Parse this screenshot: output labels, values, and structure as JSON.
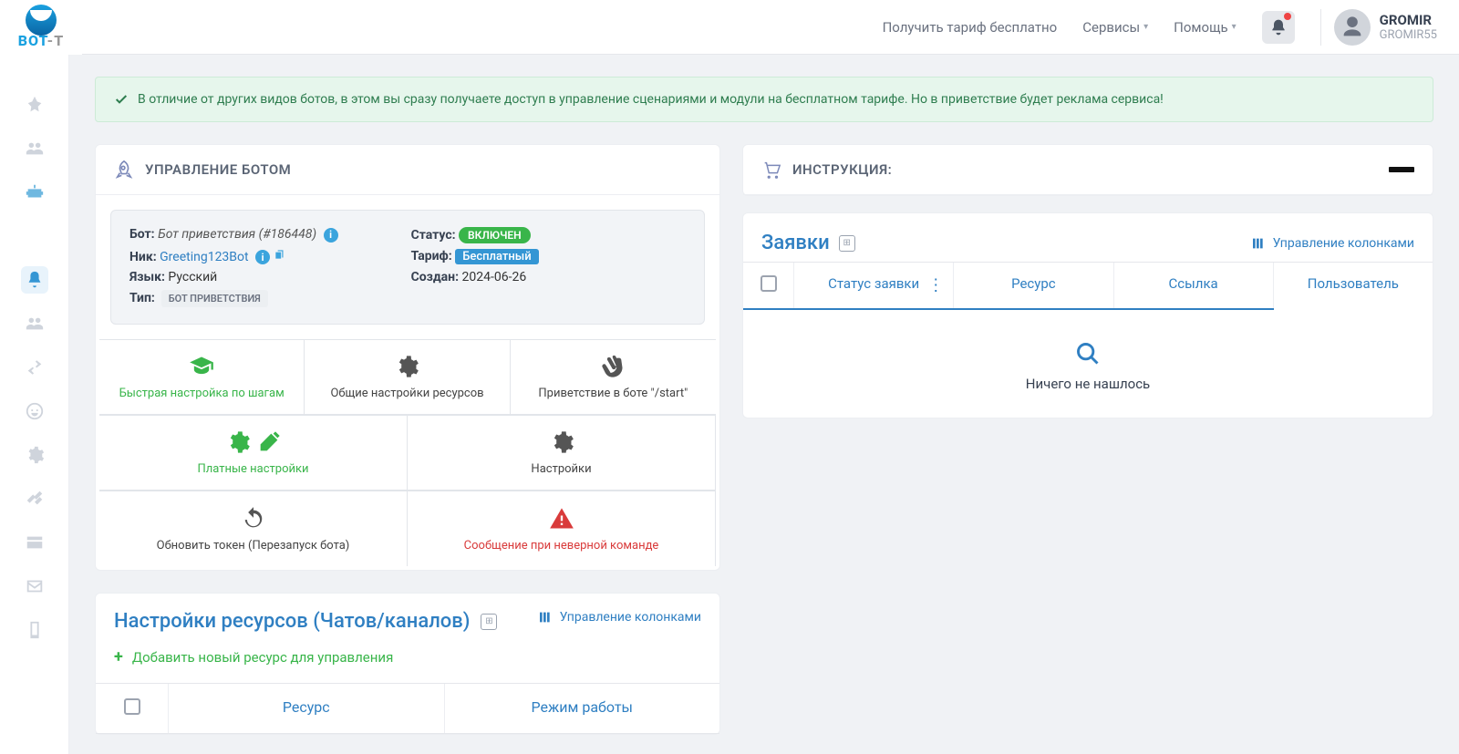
{
  "header": {
    "logo_main": "BOT",
    "logo_suffix": "-T",
    "links": {
      "free_tariff": "Получить тариф бесплатно",
      "services": "Сервисы",
      "help": "Помощь"
    },
    "user": {
      "name": "GROMIR",
      "username": "GROMIR55"
    }
  },
  "alert": "В отличие от других видов ботов, в этом вы сразу получаете доступ в управление сценариями и модули на бесплатном тарифе. Но в приветствие будет реклама сервиса!",
  "bot_panel": {
    "title": "УПРАВЛЕНИЕ БОТОМ",
    "labels": {
      "bot": "Бот:",
      "nick": "Ник:",
      "lang": "Язык:",
      "type": "Тип:",
      "status": "Статус:",
      "tariff": "Тариф:",
      "created": "Создан:"
    },
    "values": {
      "bot": "Бот приветствия (#186448)",
      "nick": "Greeting123Bot",
      "lang": "Русский",
      "type": "БОТ ПРИВЕТСТВИЯ",
      "status": "ВКЛЮЧЕН",
      "tariff": "Бесплатный",
      "created": "2024-06-26"
    },
    "tiles": {
      "quick_setup": "Быстрая настройка по шагам",
      "common_resources": "Общие настройки ресурсов",
      "greeting_bot": "Приветствие в боте \"/start\"",
      "paid_settings": "Платные настройки",
      "settings": "Настройки",
      "refresh_token": "Обновить токен (Перезапуск бота)",
      "invalid_cmd": "Сообщение при неверной команде"
    }
  },
  "instructions": {
    "title": "ИНСТРУКЦИЯ:"
  },
  "orders": {
    "title": "Заявки",
    "manage_cols": "Управление колонками",
    "columns": {
      "status": "Статус заявки",
      "resource": "Ресурс",
      "link": "Ссылка",
      "user": "Пользователь"
    },
    "empty": "Ничего не нашлось"
  },
  "resources": {
    "title": "Настройки ресурсов (Чатов/каналов)",
    "manage_cols": "Управление колонками",
    "add": "Добавить новый ресурс для управления",
    "columns": {
      "resource": "Ресурс",
      "mode": "Режим работы"
    }
  }
}
